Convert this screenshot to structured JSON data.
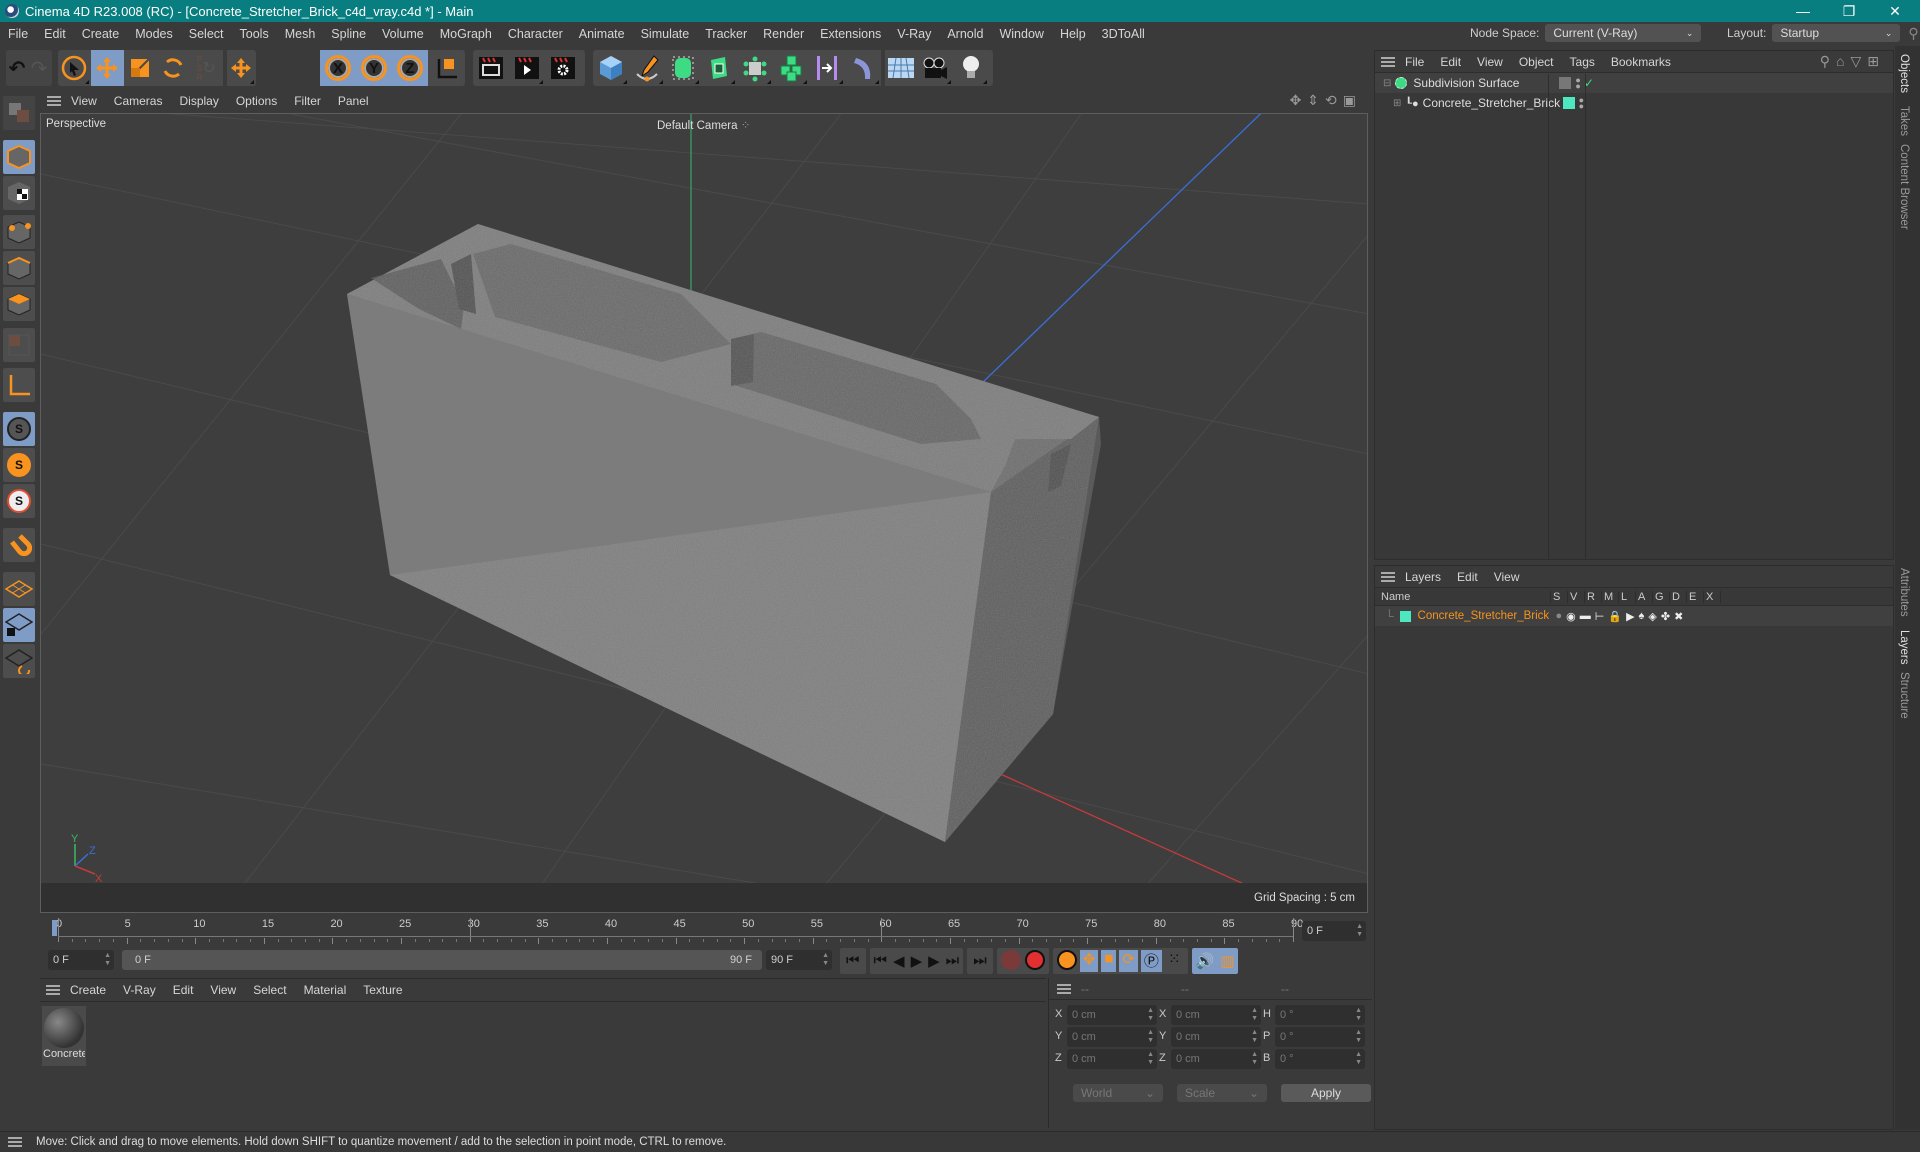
{
  "titlebar": {
    "title": "Cinema 4D R23.008 (RC) - [Concrete_Stretcher_Brick_c4d_vray.c4d *] - Main",
    "minimize": "—",
    "restore": "❐",
    "close": "✕"
  },
  "menubar": {
    "items": [
      "File",
      "Edit",
      "Create",
      "Modes",
      "Select",
      "Tools",
      "Mesh",
      "Spline",
      "Volume",
      "MoGraph",
      "Character",
      "Animate",
      "Simulate",
      "Tracker",
      "Render",
      "Extensions",
      "V-Ray",
      "Arnold",
      "Window",
      "Help",
      "3DToAll"
    ],
    "node_space_label": "Node Space:",
    "node_space_value": "Current (V-Ray)",
    "layout_label": "Layout:",
    "layout_value": "Startup"
  },
  "toolbar": {
    "undo": "undo-icon",
    "redo": "redo-icon",
    "tools": [
      "live-selection",
      "move",
      "scale",
      "rotate",
      "psr-lock",
      "coordinate-axis"
    ],
    "axes": [
      "X",
      "Y",
      "Z"
    ],
    "render": [
      "render-view",
      "render-picture-viewer",
      "render-settings"
    ],
    "create": [
      "cube",
      "pen-spline",
      "subdivision-surface",
      "extrude",
      "cloner",
      "mograph-cubes",
      "symmetry",
      "deformer",
      "floor",
      "camera",
      "light"
    ]
  },
  "viewport": {
    "menu": [
      "View",
      "Cameras",
      "Display",
      "Options",
      "Filter",
      "Panel"
    ],
    "label": "Perspective",
    "camera": "Default Camera",
    "grid_spacing": "Grid Spacing : 5 cm",
    "axis_labels": {
      "x": "X",
      "y": "Y",
      "z": "Z"
    }
  },
  "timeline": {
    "ticks": [
      "0",
      "5",
      "10",
      "15",
      "20",
      "25",
      "30",
      "35",
      "40",
      "45",
      "50",
      "55",
      "60",
      "65",
      "70",
      "75",
      "80",
      "85",
      "90"
    ],
    "current_frame": "0 F",
    "start_field": "0 F",
    "range_start": "0 F",
    "range_end": "90 F",
    "end_field": "90 F"
  },
  "material_manager": {
    "menu": [
      "Create",
      "V-Ray",
      "Edit",
      "View",
      "Select",
      "Material",
      "Texture"
    ],
    "materials": [
      {
        "name": "Concrete"
      }
    ]
  },
  "coordinates": {
    "headers": [
      "--",
      "--",
      "--"
    ],
    "rows": [
      {
        "a": "X",
        "av": "0 cm",
        "b": "X",
        "bv": "0 cm",
        "c": "H",
        "cv": "0 °"
      },
      {
        "a": "Y",
        "av": "0 cm",
        "b": "Y",
        "bv": "0 cm",
        "c": "P",
        "cv": "0 °"
      },
      {
        "a": "Z",
        "av": "0 cm",
        "b": "Z",
        "bv": "0 cm",
        "c": "B",
        "cv": "0 °"
      }
    ],
    "mode": "World",
    "transform": "Scale",
    "apply": "Apply"
  },
  "objects_panel": {
    "menu": [
      "File",
      "Edit",
      "View",
      "Object",
      "Tags",
      "Bookmarks"
    ],
    "items": [
      {
        "name": "Subdivision Surface",
        "color": "#3ddc84"
      },
      {
        "name": "Concrete_Stretcher_Brick",
        "color": "#4de8c0"
      }
    ]
  },
  "layers_panel": {
    "menu": [
      "Layers",
      "Edit",
      "View"
    ],
    "columns": [
      "Name",
      "S",
      "V",
      "R",
      "M",
      "L",
      "A",
      "G",
      "D",
      "E",
      "X"
    ],
    "rows": [
      {
        "name": "Concrete_Stretcher_Brick",
        "color": "#4de8c0"
      }
    ]
  },
  "side_tabs": {
    "top": [
      "Objects",
      "Takes",
      "Content Browser"
    ],
    "bottom": [
      "Attributes",
      "Layers",
      "Structure"
    ]
  },
  "status": "Move: Click and drag to move elements. Hold down SHIFT to quantize movement / add to the selection in point mode, CTRL to remove.",
  "colors": {
    "accent_blue": "#7f9cc7",
    "orange": "#f7931e",
    "title_teal": "#087e80",
    "layer_name": "#f7931e"
  }
}
